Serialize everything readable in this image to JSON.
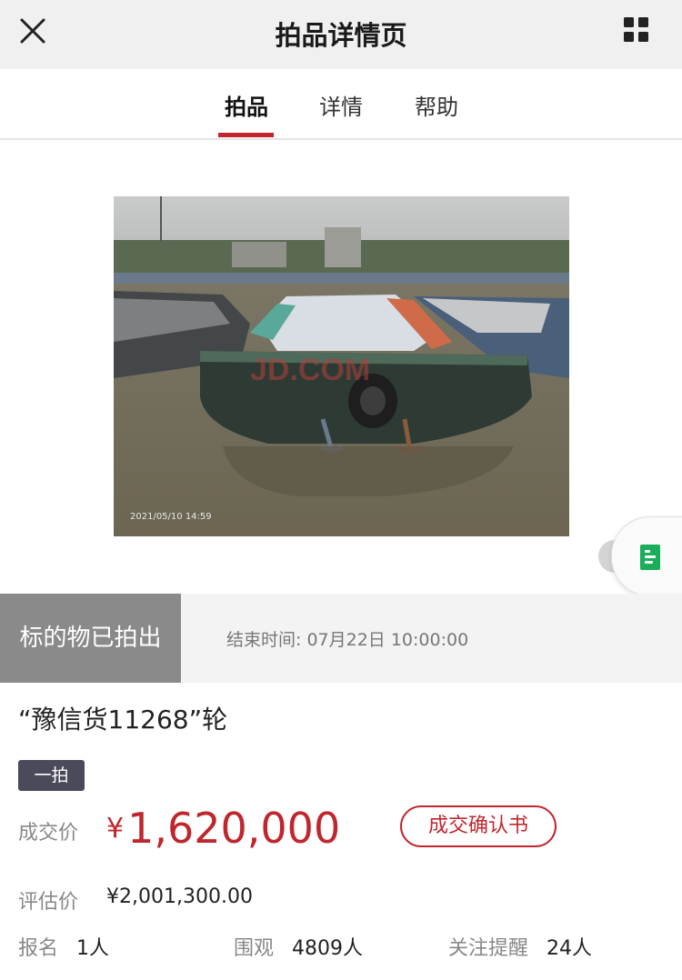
{
  "header": {
    "title": "拍品详情页"
  },
  "tabs": [
    {
      "label": "拍品",
      "active": true
    },
    {
      "label": "详情",
      "active": false
    },
    {
      "label": "帮助",
      "active": false
    }
  ],
  "photo": {
    "timestamp": "2021/05/10 14:59",
    "watermark": "JD.COM"
  },
  "status": {
    "sold_label": "标的物已拍出",
    "end_time_label": "结束时间:",
    "end_time_value": "07月22日 10:00:00"
  },
  "lot": {
    "title": "“豫信货11268”轮",
    "round_badge": "一拍"
  },
  "deal": {
    "label": "成交价",
    "currency": "¥",
    "price": "1,620,000",
    "confirm_button": "成交确认书"
  },
  "evaluation": {
    "label": "评估价",
    "value": "¥2,001,300.00"
  },
  "stats": [
    {
      "key": "报名",
      "value": "1人"
    },
    {
      "key": "围观",
      "value": "4809人"
    },
    {
      "key": "关注提醒",
      "value": "24人"
    }
  ],
  "colors": {
    "accent": "#c0262d",
    "sold_bg": "#8a8a8a",
    "badge_bg": "#4a4a5a",
    "float_icon": "#1aad5b"
  },
  "icons": {
    "close": "close-icon",
    "menu": "grid-icon",
    "float": "document-icon"
  }
}
